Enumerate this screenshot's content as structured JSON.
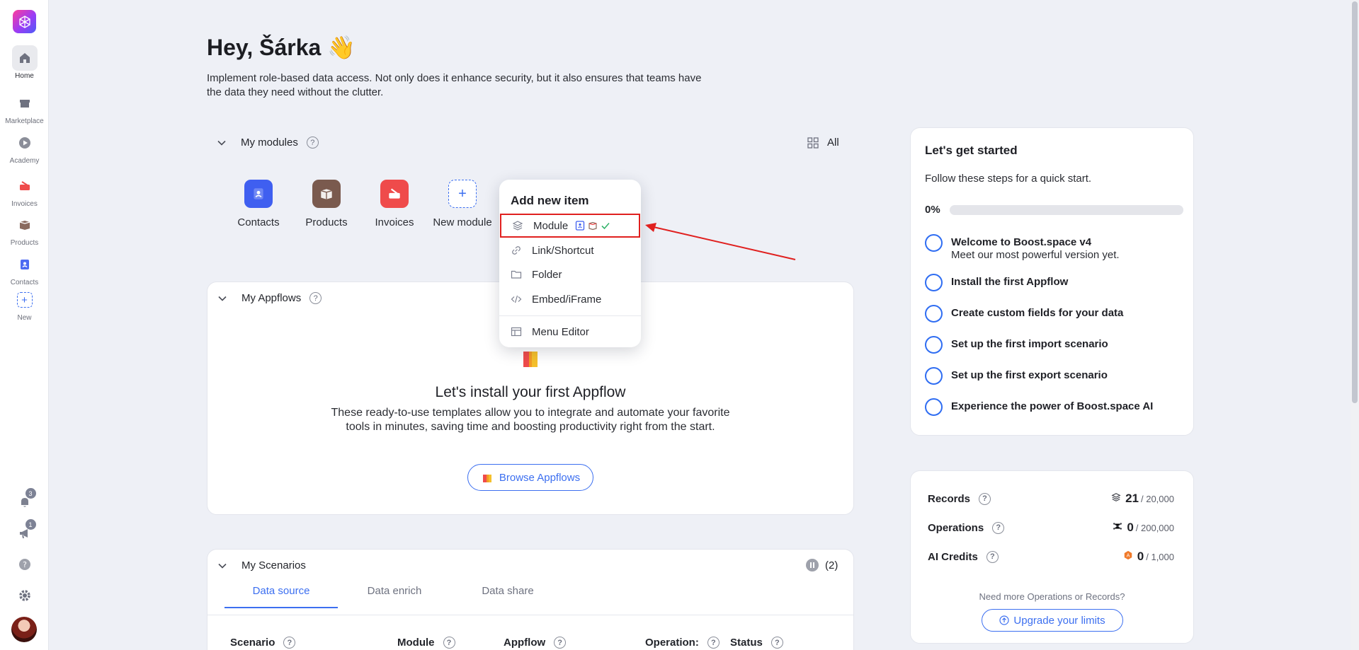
{
  "sidebar": {
    "items": [
      {
        "label": "Home",
        "icon": "home-icon"
      },
      {
        "label": "Marketplace",
        "icon": "store-icon"
      },
      {
        "label": "Academy",
        "icon": "play-icon"
      },
      {
        "label": "Invoices",
        "icon": "invoice-icon"
      },
      {
        "label": "Products",
        "icon": "product-box-icon"
      },
      {
        "label": "Contacts",
        "icon": "contacts-icon"
      },
      {
        "label": "New",
        "icon": "plus-icon"
      }
    ],
    "notifications_count": "3",
    "announcements_count": "1"
  },
  "header": {
    "greeting": "Hey, Šárka 👋",
    "intro": "Implement role-based data access. Not only does it enhance security, but it also ensures that teams have the data they need without the clutter."
  },
  "modules": {
    "title": "My modules",
    "help": "?",
    "all_label": "All",
    "items": [
      {
        "label": "Contacts",
        "color": "#3f5ff0"
      },
      {
        "label": "Products",
        "color": "#7a5a4e"
      },
      {
        "label": "Invoices",
        "color": "#ef4b4b"
      },
      {
        "label": "New module",
        "color": "#3c6ff0"
      }
    ]
  },
  "popup": {
    "title": "Add new item",
    "items": [
      "Module",
      "Link/Shortcut",
      "Folder",
      "Embed/iFrame",
      "Menu Editor"
    ]
  },
  "appflows": {
    "title": "My Appflows",
    "headline": "Let's install your first Appflow",
    "description": "These ready-to-use templates allow you to integrate and automate your favorite tools in minutes, saving time and boosting productivity right from the start.",
    "browse_label": "Browse Appflows"
  },
  "scenarios": {
    "title": "My Scenarios",
    "count": "(2)",
    "tabs": [
      "Data source",
      "Data enrich",
      "Data share"
    ],
    "columns": [
      "Scenario",
      "Module",
      "Appflow",
      "Operation:",
      "Status"
    ]
  },
  "getting_started": {
    "title": "Let's get started",
    "subtitle": "Follow these steps for a quick start.",
    "progress_label": "0%",
    "progress": 0,
    "steps": [
      {
        "title": "Welcome to Boost.space v4",
        "subtitle": "Meet our most powerful version yet."
      },
      {
        "title": "Install the first Appflow"
      },
      {
        "title": "Create custom fields for your data"
      },
      {
        "title": "Set up the first import scenario"
      },
      {
        "title": "Set up the first export scenario"
      },
      {
        "title": "Experience the power of Boost.space AI"
      }
    ]
  },
  "usage": {
    "rows": [
      {
        "label": "Records",
        "value": "21",
        "limit": "/ 20,000"
      },
      {
        "label": "Operations",
        "value": "0",
        "limit": "/ 200,000"
      },
      {
        "label": "AI Credits",
        "value": "0",
        "limit": "/ 1,000"
      }
    ],
    "need_more": "Need more Operations or Records?",
    "upgrade_label": "Upgrade your limits"
  },
  "colors": {
    "accent": "#3c6ff0",
    "highlight": "#e0201f"
  }
}
